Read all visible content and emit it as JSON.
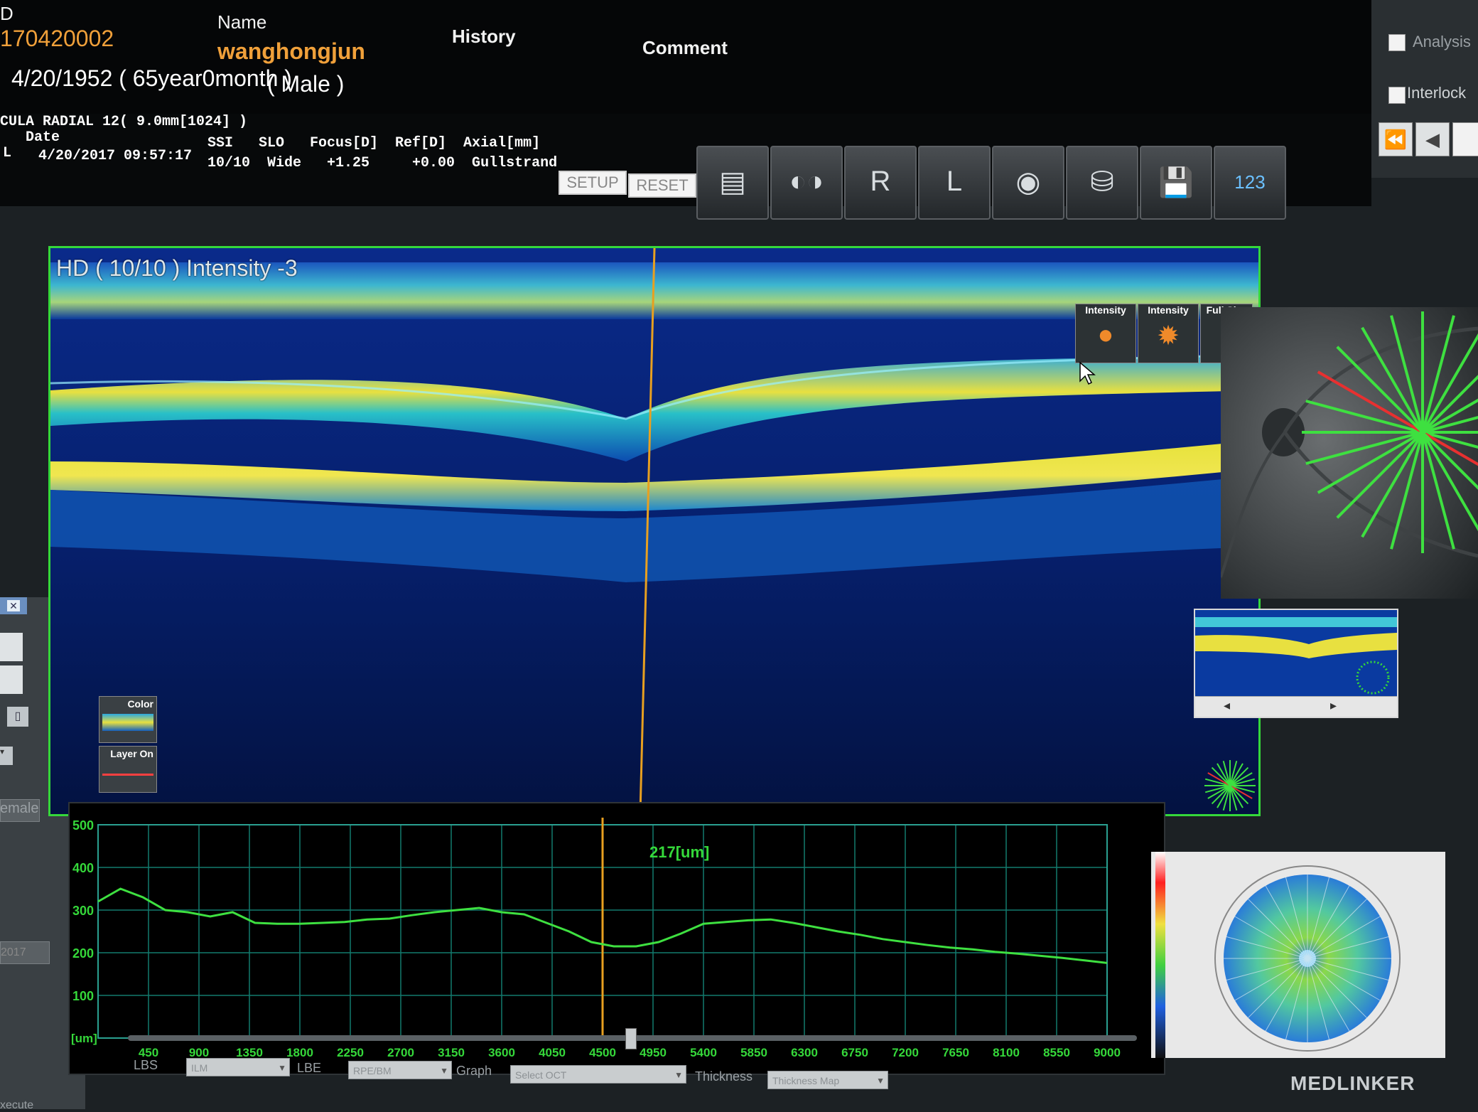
{
  "header": {
    "id_label": "D",
    "id_value": "170420002",
    "name_label": "Name",
    "name_value": "wanghongjun",
    "dob": "4/20/1952 ( 65year0month )",
    "sex": "( Male )",
    "history_label": "History",
    "comment_label": "Comment"
  },
  "right_ctrl": {
    "analysis_label": "Analysis",
    "interlock_label": "Interlock",
    "rewind_icon": "⏪",
    "back_icon": "◀"
  },
  "scan_info": {
    "protocol": "CULA RADIAL 12( 9.0mm[1024] )",
    "date_label": "Date",
    "cols_label": "SSI   SLO   Focus[D]  Ref[D]  Axial[mm]",
    "eye": "L",
    "date_value": "4/20/2017 09:57:17",
    "values": "10/10  Wide   +1.25     +0.00  Gullstrand",
    "setup_label": "SETUP",
    "reset_label": "RESET"
  },
  "toolbar": {
    "buttons": [
      {
        "name": "report-print-button",
        "glyph": "▤"
      },
      {
        "name": "both-eyes-button",
        "glyph": "◐◑"
      },
      {
        "name": "right-eye-button",
        "glyph": "R"
      },
      {
        "name": "left-eye-button",
        "glyph": "L"
      },
      {
        "name": "capture-button",
        "glyph": "◉"
      },
      {
        "name": "export-button",
        "glyph": "⛁"
      },
      {
        "name": "save-button",
        "glyph": "💾"
      },
      {
        "name": "data-list-button",
        "glyph": "123"
      }
    ]
  },
  "oct": {
    "title": "HD ( 10/10 ) Intensity -3",
    "intensity_label_1": "Intensity",
    "intensity_label_2": "Intensity",
    "fullsize_label": "Full Size",
    "color_label": "Color",
    "layer_label": "Layer On"
  },
  "graph": {
    "readout": "217[um]",
    "unit_label": "[um]",
    "y_ticks": [
      "500",
      "400",
      "300",
      "200",
      "100"
    ],
    "x_ticks": [
      "450",
      "900",
      "1350",
      "1800",
      "2250",
      "2700",
      "3150",
      "3600",
      "4050",
      "4500",
      "4950",
      "5400",
      "5850",
      "6300",
      "6750",
      "7200",
      "7650",
      "8100",
      "8550",
      "9000"
    ]
  },
  "chart_data": {
    "type": "line",
    "title": "",
    "xlabel": "",
    "ylabel": "[um]",
    "xlim": [
      0,
      9000
    ],
    "ylim": [
      0,
      500
    ],
    "grid": true,
    "cursor_x": 4500,
    "cursor_value": 217,
    "series": [
      {
        "x": [
          0,
          200,
          400,
          600,
          800,
          1000,
          1200,
          1400,
          1600,
          1800,
          2000,
          2200,
          2400,
          2600,
          2800,
          3000,
          3200,
          3400,
          3600,
          3800,
          4000,
          4200,
          4400,
          4600,
          4800,
          5000,
          5200,
          5400,
          5600,
          5800,
          6000,
          6200,
          6400,
          6600,
          6800,
          7000,
          7200,
          7400,
          7600,
          7800,
          8000,
          8200,
          8400,
          8600,
          8800,
          9000
        ],
        "y": [
          320,
          350,
          330,
          300,
          295,
          285,
          295,
          270,
          268,
          268,
          270,
          272,
          278,
          280,
          288,
          295,
          300,
          305,
          295,
          290,
          270,
          250,
          225,
          215,
          215,
          225,
          245,
          268,
          272,
          276,
          278,
          270,
          260,
          250,
          242,
          232,
          225,
          218,
          212,
          208,
          202,
          198,
          193,
          188,
          182,
          176
        ]
      }
    ]
  },
  "bottom": {
    "lbs_label": "LBS",
    "lbs_value": "ILM",
    "lbe_label": "LBE",
    "lbe_value": "RPE/BM",
    "graph_label": "Graph",
    "graph_value": "Select OCT",
    "thickness_label": "Thickness",
    "thickness_value": "Thickness Map"
  },
  "left_panel": {
    "female_label": "emale",
    "year_value": "2017",
    "execute_label": "xecute"
  },
  "thumb": {
    "prev": "◂",
    "next": "▸"
  },
  "watermark": "MEDLINKER",
  "colors": {
    "accent_green": "#35d83a",
    "patient_id": "#f0a03a",
    "cursor_line": "#e8a020"
  }
}
